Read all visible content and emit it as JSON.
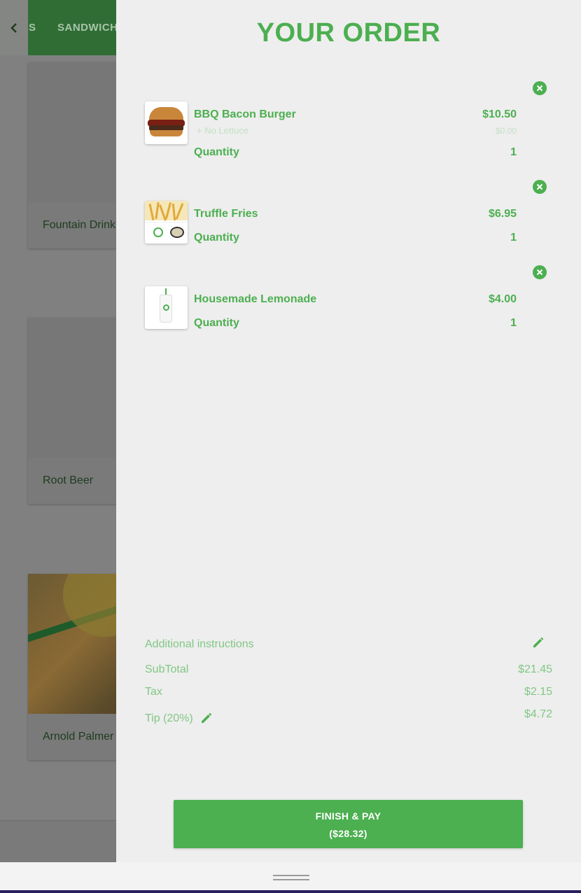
{
  "background": {
    "tabs": [
      "S",
      "SANDWICH"
    ],
    "cards": [
      "Fountain Drink",
      "Root Beer",
      "Arnold Palmer"
    ]
  },
  "order": {
    "title": "YOUR ORDER",
    "items": [
      {
        "name": "BBQ Bacon Burger",
        "price": "$10.50",
        "modifier": "+ No Lettuce",
        "modifier_price": "$0.00",
        "quantity_label": "Quantity",
        "quantity": "1"
      },
      {
        "name": "Truffle Fries",
        "price": "$6.95",
        "quantity_label": "Quantity",
        "quantity": "1"
      },
      {
        "name": "Housemade Lemonade",
        "price": "$4.00",
        "quantity_label": "Quantity",
        "quantity": "1"
      }
    ],
    "summary": {
      "instructions_label": "Additional instructions",
      "subtotal_label": "SubTotal",
      "subtotal": "$21.45",
      "tax_label": "Tax",
      "tax": "$2.15",
      "tip_label": "Tip (20%)",
      "tip": "$4.72"
    },
    "pay_button": {
      "label": "FINISH & PAY",
      "amount": "($28.32)"
    }
  },
  "colors": {
    "accent": "#4caf50",
    "accent_light": "#81c784",
    "panel_bg": "#eeeeee"
  },
  "icons": [
    "chevron-left-icon",
    "close-circle-icon",
    "pencil-icon"
  ]
}
